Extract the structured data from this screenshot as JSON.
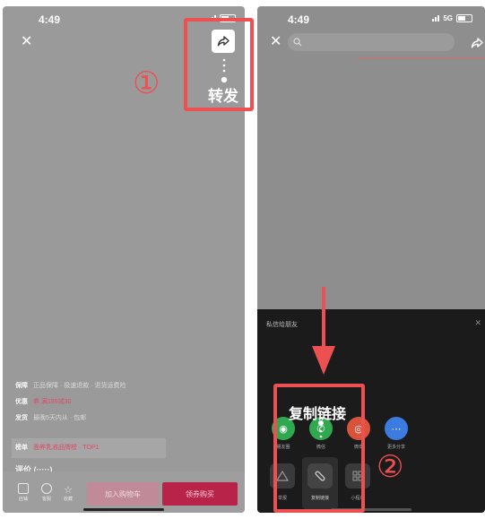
{
  "left_screen": {
    "time": "4:49",
    "close_icon": "close-icon",
    "share_icon": "share-forward-icon",
    "share_label": "转发",
    "step_marker": "①",
    "info": {
      "row1_label": "保障",
      "row1_value": "正品保障 · 极速退款 · 退货运费险",
      "row2_label": "优惠",
      "row2_value": "券 满199减30",
      "row3_label": "发货",
      "row3_value": "最晚5天内从    ·   包邮",
      "row4_label": "榜单",
      "row4_value": "面养乳液品牌榜 · TOP1",
      "review": "评价 (·····)"
    },
    "bottom_bar": {
      "icons": [
        "店铺",
        "客服",
        "收藏"
      ],
      "cart_label": "加入购物车",
      "buy_label": "领券购买"
    }
  },
  "right_screen": {
    "time": "4:49",
    "network": "5G",
    "close_icon": "close-icon",
    "search_icon": "search-icon",
    "share_icon": "share-forward-icon",
    "sheet_title": "私信给朋友",
    "copy_link_label": "复制链接",
    "step_marker": "②",
    "share_targets": [
      {
        "label": "朋友圈",
        "color": "#2fa84f"
      },
      {
        "label": "微信",
        "color": "#2fa84f"
      },
      {
        "label": "微博",
        "color": "#d9533a"
      },
      {
        "label": "更多分享",
        "color": "#3c7be0"
      }
    ],
    "actions": [
      {
        "label": "举报"
      },
      {
        "label": "复制链接"
      },
      {
        "label": "小程序"
      }
    ]
  },
  "colors": {
    "annotation_red": "#ec5050",
    "buy_red": "#b8234a"
  }
}
